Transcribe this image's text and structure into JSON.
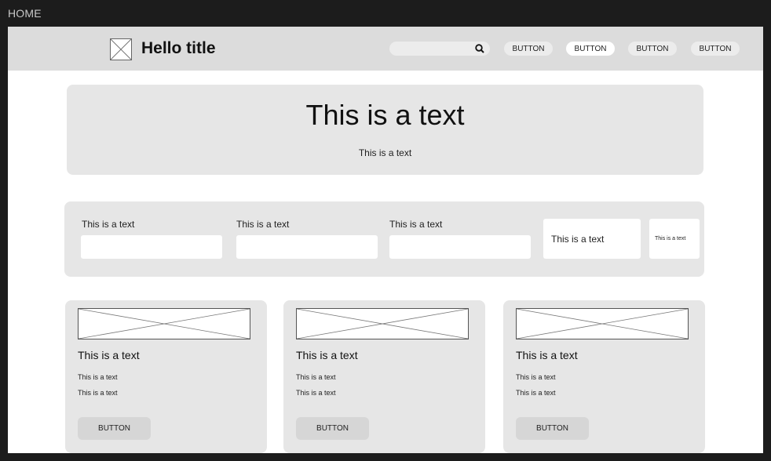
{
  "frame": {
    "label": "HOME"
  },
  "header": {
    "title": "Hello title",
    "search": {
      "value": "",
      "placeholder": ""
    },
    "buttons": [
      "BUTTON",
      "BUTTON",
      "BUTTON",
      "BUTTON"
    ]
  },
  "hero": {
    "title": "This is a text",
    "subtitle": "This is a text"
  },
  "form": {
    "fields": [
      {
        "label": "This is a text"
      },
      {
        "label": "This is a text"
      },
      {
        "label": "This is a text"
      }
    ],
    "box_large": "This is a text",
    "box_small": "This is a text"
  },
  "cards": [
    {
      "title": "This is a text",
      "line1": "This is a text",
      "line2": "This is a text",
      "button": "BUTTON"
    },
    {
      "title": "This is a text",
      "line1": "This is a text",
      "line2": "This is a text",
      "button": "BUTTON"
    },
    {
      "title": "This is a text",
      "line1": "This is a text",
      "line2": "This is a text",
      "button": "BUTTON"
    }
  ],
  "colors": {
    "frame": "#1c1c1c",
    "navbar": "#dcdcdc",
    "panel": "#e6e6e6",
    "canvas": "#ffffff"
  }
}
